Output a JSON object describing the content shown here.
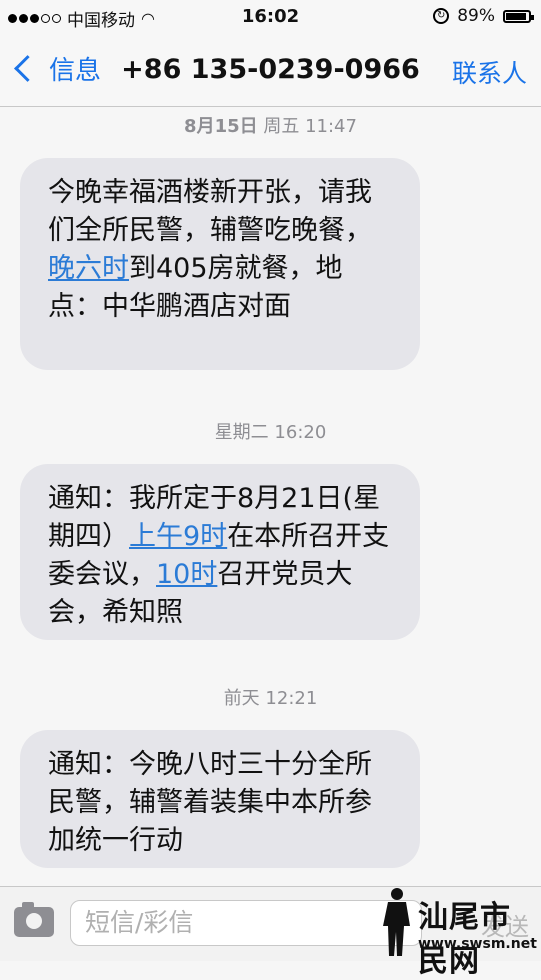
{
  "status_bar": {
    "carrier": "中国移动",
    "time": "16:02",
    "battery": "89%",
    "battery_level": 0.89
  },
  "nav": {
    "back_label": "信息",
    "title": "+86 135-0239-0966",
    "contact_label": "联系人"
  },
  "messages": [
    {
      "timestamp_bold": "8月15日",
      "timestamp_rest": " 周五 11:47",
      "parts": [
        "今晚幸福酒楼新开张，请我们全所民警，辅警吃晚餐，",
        "晚六时",
        "到405房就餐，地点：中华鹏酒店对面"
      ]
    },
    {
      "timestamp": "星期二 16:20",
      "parts": [
        "通知：我所定于8月21日(星期四）",
        "上午9时",
        "在本所召开支委会议，",
        "10时",
        "召开党员大会，希知照"
      ]
    },
    {
      "timestamp": "前天 12:21",
      "text": "通知：今晚八时三十分全所民警，辅警着装集中本所参加统一行动"
    }
  ],
  "input_bar": {
    "placeholder": "短信/彩信",
    "send_label": "发送"
  },
  "watermark": {
    "text": "汕尾市民网",
    "url": "www.swsm.net"
  }
}
